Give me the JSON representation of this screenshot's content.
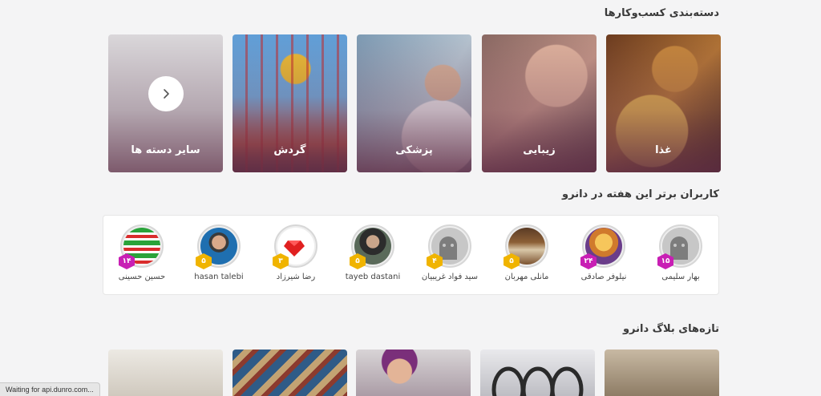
{
  "categories": {
    "title": "دسته‌بندی کسب‌وکارها",
    "items": [
      {
        "label": "غذا",
        "icon": "food-image"
      },
      {
        "label": "زیبایی",
        "icon": "beauty-image"
      },
      {
        "label": "پزشکی",
        "icon": "medical-image"
      },
      {
        "label": "گردش",
        "icon": "amusement-park-image"
      },
      {
        "label": "سایر دسته ها",
        "icon": "chevron-right-icon"
      }
    ]
  },
  "top_users": {
    "title": "کاربران برتر این هفته در دانرو",
    "users": [
      {
        "name": "بهار سلیمی",
        "badge": "۱۵",
        "badge_color": "#c81fb4"
      },
      {
        "name": "نیلوفر صادقی",
        "badge": "۲۴",
        "badge_color": "#c81fb4"
      },
      {
        "name": "مانلی مهربان",
        "badge": "۵",
        "badge_color": "#f0b400"
      },
      {
        "name": "سید فواد غریبیان",
        "badge": "۴",
        "badge_color": "#f0b400"
      },
      {
        "name": "tayeb dastani",
        "badge": "۵",
        "badge_color": "#f0b400"
      },
      {
        "name": "رضا شیرزاد",
        "badge": "۳",
        "badge_color": "#f0b400"
      },
      {
        "name": "hasan talebi",
        "badge": "۵",
        "badge_color": "#f0b400"
      },
      {
        "name": "حسین حسینی",
        "badge": "۱۴",
        "badge_color": "#c81fb4"
      }
    ]
  },
  "blog": {
    "title": "تازه‌های بلاگ دانرو"
  },
  "status_bar": {
    "text": "Waiting for api.dunro.com..."
  }
}
